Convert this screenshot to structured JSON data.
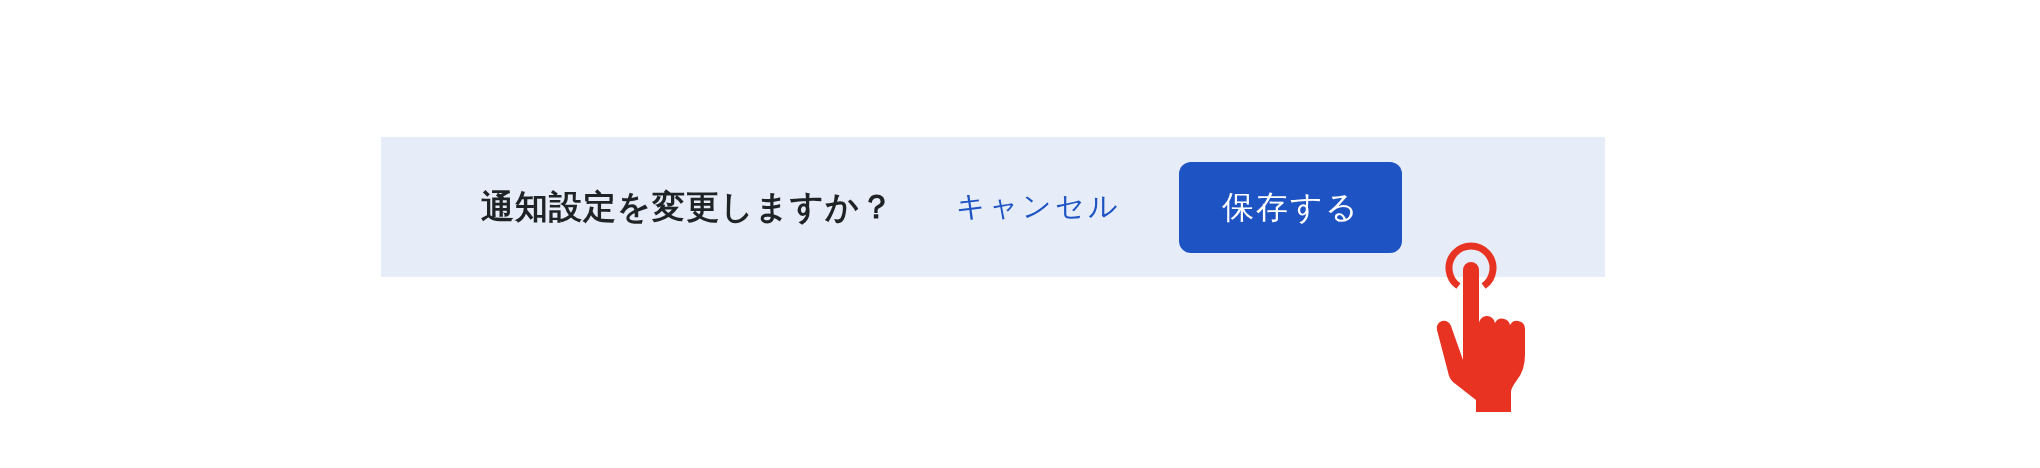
{
  "dialog": {
    "message": "通知設定を変更しますか？",
    "buttons": [
      {
        "label": "キャンセル",
        "kind": "link"
      },
      {
        "label": "保存する",
        "kind": "primary"
      }
    ],
    "pointer": {
      "kind": "tap"
    }
  }
}
